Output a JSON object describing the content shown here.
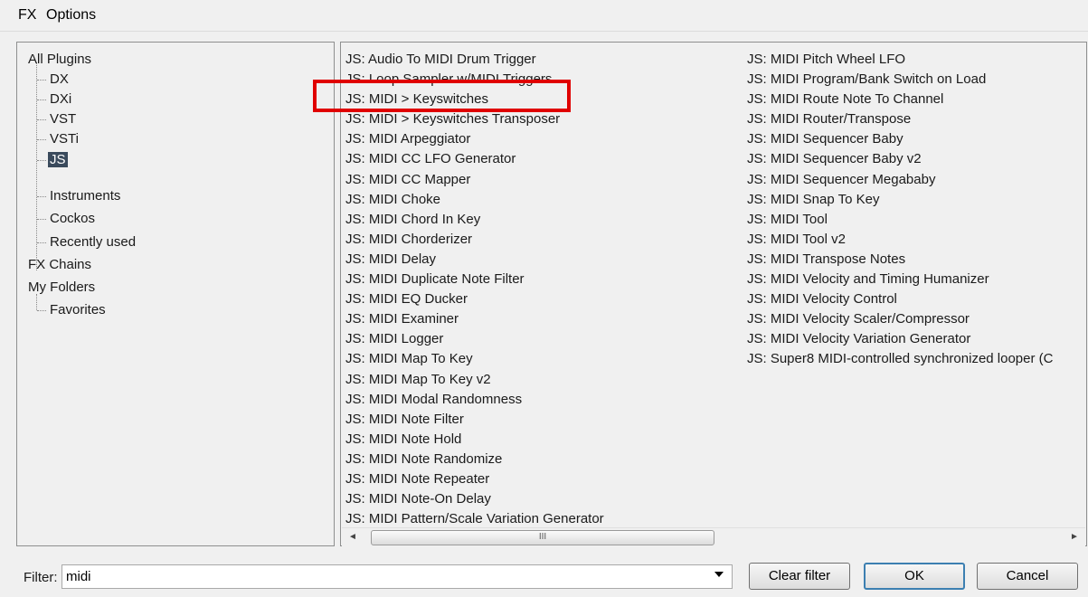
{
  "menu": {
    "fx": "FX",
    "options": "Options"
  },
  "tree": {
    "all_plugins": "All Plugins",
    "dx": "DX",
    "dxi": "DXi",
    "vst": "VST",
    "vsti": "VSTi",
    "js": "JS",
    "instruments": "Instruments",
    "cockos": "Cockos",
    "recently_used": "Recently used",
    "fx_chains": "FX Chains",
    "my_folders": "My Folders",
    "favorites": "Favorites",
    "selected_item": "JS"
  },
  "list": {
    "col1": [
      "JS: Audio To MIDI Drum Trigger",
      "JS: Loop Sampler w/MIDI Triggers",
      "JS: MIDI > Keyswitches",
      "JS: MIDI > Keyswitches Transposer",
      "JS: MIDI Arpeggiator",
      "JS: MIDI CC LFO Generator",
      "JS: MIDI CC Mapper",
      "JS: MIDI Choke",
      "JS: MIDI Chord In Key",
      "JS: MIDI Chorderizer",
      "JS: MIDI Delay",
      "JS: MIDI Duplicate Note Filter",
      "JS: MIDI EQ Ducker",
      "JS: MIDI Examiner",
      "JS: MIDI Logger",
      "JS: MIDI Map To Key",
      "JS: MIDI Map To Key v2",
      "JS: MIDI Modal Randomness",
      "JS: MIDI Note Filter",
      "JS: MIDI Note Hold",
      "JS: MIDI Note Randomize",
      "JS: MIDI Note Repeater",
      "JS: MIDI Note-On Delay",
      "JS: MIDI Pattern/Scale Variation Generator"
    ],
    "col2": [
      "JS: MIDI Pitch Wheel LFO",
      "JS: MIDI Program/Bank Switch on Load",
      "JS: MIDI Route Note To Channel",
      "JS: MIDI Router/Transpose",
      "JS: MIDI Sequencer Baby",
      "JS: MIDI Sequencer Baby v2",
      "JS: MIDI Sequencer Megababy",
      "JS: MIDI Snap To Key",
      "JS: MIDI Tool",
      "JS: MIDI Tool v2",
      "JS: MIDI Transpose Notes",
      "JS: MIDI Velocity and Timing Humanizer",
      "JS: MIDI Velocity Control",
      "JS: MIDI Velocity Scaler/Compressor",
      "JS: MIDI Velocity Variation Generator",
      "JS: Super8 MIDI-controlled synchronized looper (C"
    ],
    "highlighted_item": "JS: MIDI > Keyswitches"
  },
  "scrollbar": {
    "left_arrow": "◄",
    "right_arrow": "►",
    "thumb_grip": "III"
  },
  "filter": {
    "label": "Filter:",
    "value": "midi"
  },
  "buttons": {
    "clear_filter": "Clear filter",
    "ok": "OK",
    "cancel": "Cancel"
  },
  "colors": {
    "highlight_border": "#e00000",
    "selected_bg": "#3a4a5c",
    "default_button_border": "#3c7fb1"
  }
}
